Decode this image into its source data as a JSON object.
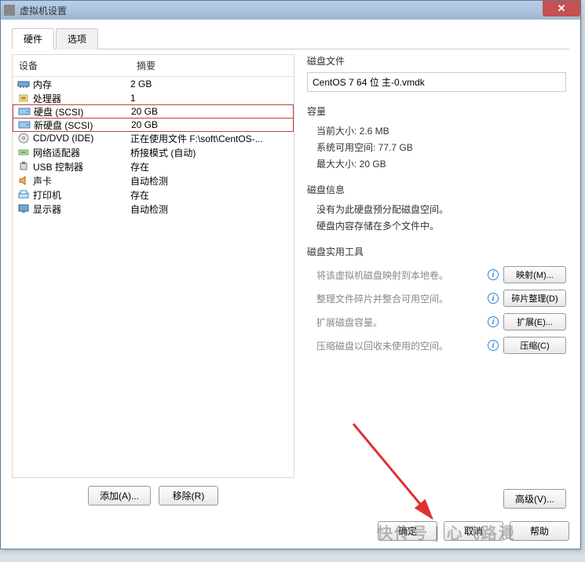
{
  "window": {
    "title": "虚拟机设置"
  },
  "tabs": {
    "hardware": "硬件",
    "options": "选项"
  },
  "device_headers": {
    "name": "设备",
    "summary": "摘要"
  },
  "devices": [
    {
      "icon": "memory-icon",
      "name": "内存",
      "summary": "2 GB",
      "hl": false
    },
    {
      "icon": "cpu-icon",
      "name": "处理器",
      "summary": "1",
      "hl": false
    },
    {
      "icon": "disk-icon",
      "name": "硬盘 (SCSI)",
      "summary": "20 GB",
      "hl": true
    },
    {
      "icon": "disk-icon",
      "name": "新硬盘 (SCSI)",
      "summary": "20 GB",
      "hl": true
    },
    {
      "icon": "cd-icon",
      "name": "CD/DVD (IDE)",
      "summary": "正在使用文件 F:\\soft\\CentOS-...",
      "hl": false
    },
    {
      "icon": "net-icon",
      "name": "网络适配器",
      "summary": "桥接模式 (自动)",
      "hl": false
    },
    {
      "icon": "usb-icon",
      "name": "USB 控制器",
      "summary": "存在",
      "hl": false
    },
    {
      "icon": "sound-icon",
      "name": "声卡",
      "summary": "自动检测",
      "hl": false
    },
    {
      "icon": "printer-icon",
      "name": "打印机",
      "summary": "存在",
      "hl": false
    },
    {
      "icon": "display-icon",
      "name": "显示器",
      "summary": "自动检测",
      "hl": false
    }
  ],
  "left_buttons": {
    "add": "添加(A)...",
    "remove": "移除(R)"
  },
  "right": {
    "disk_file": {
      "title": "磁盘文件",
      "value": "CentOS 7 64 位 主-0.vmdk"
    },
    "capacity": {
      "title": "容量",
      "current": "当前大小: 2.6 MB",
      "free": "系统可用空间: 77.7 GB",
      "max": "最大大小: 20 GB"
    },
    "disk_info": {
      "title": "磁盘信息",
      "line1": "没有为此硬盘预分配磁盘空间。",
      "line2": "硬盘内容存储在多个文件中。"
    },
    "tools": {
      "title": "磁盘实用工具",
      "map_label": "将该虚拟机磁盘映射到本地卷。",
      "map_btn": "映射(M)...",
      "defrag_label": "整理文件碎片并整合可用空间。",
      "defrag_btn": "碎片整理(D)",
      "expand_label": "扩展磁盘容量。",
      "expand_btn": "扩展(E)...",
      "compact_label": "压缩磁盘以回收未使用的空间。",
      "compact_btn": "压缩(C)"
    },
    "advanced": "高级(V)..."
  },
  "footer": {
    "ok": "确定",
    "cancel": "取消",
    "help": "帮助"
  },
  "watermark": "快传号 | 心飞路漫"
}
